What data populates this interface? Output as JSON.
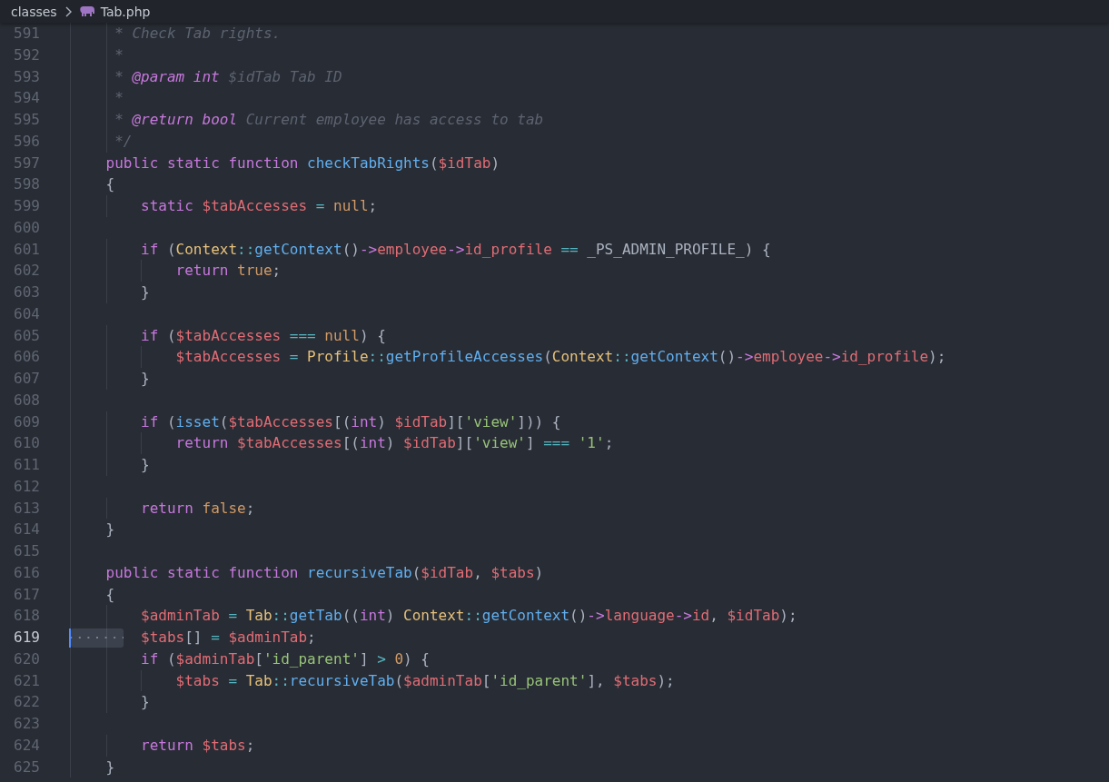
{
  "breadcrumb": {
    "folder": "classes",
    "file": "Tab.php"
  },
  "lines": [
    {
      "number": "591",
      "selected": false,
      "tokens": [
        {
          "text": "     * Check Tab rights.",
          "kind": "comment"
        }
      ]
    },
    {
      "number": "592",
      "selected": false,
      "tokens": [
        {
          "text": "     *",
          "kind": "comment"
        }
      ]
    },
    {
      "number": "593",
      "selected": false,
      "tokens": [
        {
          "text": "     * ",
          "kind": "comment"
        },
        {
          "text": "@param",
          "kind": "doctag"
        },
        {
          "text": " int",
          "kind": "doctag"
        },
        {
          "text": " $idTab Tab ID",
          "kind": "comment"
        }
      ]
    },
    {
      "number": "594",
      "selected": false,
      "tokens": [
        {
          "text": "     *",
          "kind": "comment"
        }
      ]
    },
    {
      "number": "595",
      "selected": false,
      "tokens": [
        {
          "text": "     * ",
          "kind": "comment"
        },
        {
          "text": "@return",
          "kind": "doctag"
        },
        {
          "text": " bool",
          "kind": "doctag"
        },
        {
          "text": " Current employee has access to tab",
          "kind": "comment"
        }
      ]
    },
    {
      "number": "596",
      "selected": false,
      "tokens": [
        {
          "text": "     */",
          "kind": "comment"
        }
      ]
    },
    {
      "number": "597",
      "selected": false,
      "tokens": [
        {
          "text": "    public static function",
          "kind": "keyword"
        },
        {
          "text": " checkTabRights",
          "kind": "function"
        },
        {
          "text": "(",
          "kind": "punct"
        },
        {
          "text": "$idTab",
          "kind": "variable"
        },
        {
          "text": ")",
          "kind": "punct"
        }
      ]
    },
    {
      "number": "598",
      "selected": false,
      "tokens": [
        {
          "text": "    {",
          "kind": "punct"
        }
      ]
    },
    {
      "number": "599",
      "selected": false,
      "tokens": [
        {
          "text": "        static",
          "kind": "keyword"
        },
        {
          "text": " $tabAccesses",
          "kind": "variable"
        },
        {
          "text": " =",
          "kind": "operator"
        },
        {
          "text": " null",
          "kind": "constant"
        },
        {
          "text": ";",
          "kind": "punct"
        }
      ]
    },
    {
      "number": "600",
      "selected": false
    },
    {
      "number": "601",
      "selected": false,
      "tokens": [
        {
          "text": "        if",
          "kind": "keyword"
        },
        {
          "text": " (",
          "kind": "punct"
        },
        {
          "text": "Context",
          "kind": "class"
        },
        {
          "text": "::",
          "kind": "operator"
        },
        {
          "text": "getContext",
          "kind": "function"
        },
        {
          "text": "()",
          "kind": "punct"
        },
        {
          "text": "->",
          "kind": "keyword"
        },
        {
          "text": "employee",
          "kind": "variable"
        },
        {
          "text": "->",
          "kind": "keyword"
        },
        {
          "text": "id_profile",
          "kind": "variable"
        },
        {
          "text": " ==",
          "kind": "operator"
        },
        {
          "text": " _PS_ADMIN_PROFILE_",
          "kind": "punct"
        },
        {
          "text": ") {",
          "kind": "punct"
        }
      ]
    },
    {
      "number": "602",
      "selected": false,
      "tokens": [
        {
          "text": "            return",
          "kind": "keyword"
        },
        {
          "text": " true",
          "kind": "constant"
        },
        {
          "text": ";",
          "kind": "punct"
        }
      ]
    },
    {
      "number": "603",
      "selected": false,
      "tokens": [
        {
          "text": "        }",
          "kind": "punct"
        }
      ]
    },
    {
      "number": "604",
      "selected": false
    },
    {
      "number": "605",
      "selected": false,
      "tokens": [
        {
          "text": "        if",
          "kind": "keyword"
        },
        {
          "text": " (",
          "kind": "punct"
        },
        {
          "text": "$tabAccesses",
          "kind": "variable"
        },
        {
          "text": " ===",
          "kind": "operator"
        },
        {
          "text": " null",
          "kind": "constant"
        },
        {
          "text": ") {",
          "kind": "punct"
        }
      ]
    },
    {
      "number": "606",
      "selected": false,
      "tokens": [
        {
          "text": "            $tabAccesses",
          "kind": "variable"
        },
        {
          "text": " =",
          "kind": "operator"
        },
        {
          "text": " Profile",
          "kind": "class"
        },
        {
          "text": "::",
          "kind": "operator"
        },
        {
          "text": "getProfileAccesses",
          "kind": "function"
        },
        {
          "text": "(",
          "kind": "punct"
        },
        {
          "text": "Context",
          "kind": "class"
        },
        {
          "text": "::",
          "kind": "operator"
        },
        {
          "text": "getContext",
          "kind": "function"
        },
        {
          "text": "()",
          "kind": "punct"
        },
        {
          "text": "->",
          "kind": "keyword"
        },
        {
          "text": "employee",
          "kind": "variable"
        },
        {
          "text": "->",
          "kind": "keyword"
        },
        {
          "text": "id_profile",
          "kind": "variable"
        },
        {
          "text": ");",
          "kind": "punct"
        }
      ]
    },
    {
      "number": "607",
      "selected": false,
      "tokens": [
        {
          "text": "        }",
          "kind": "punct"
        }
      ]
    },
    {
      "number": "608",
      "selected": false
    },
    {
      "number": "609",
      "selected": false,
      "tokens": [
        {
          "text": "        if",
          "kind": "keyword"
        },
        {
          "text": " (",
          "kind": "punct"
        },
        {
          "text": "isset",
          "kind": "function"
        },
        {
          "text": "(",
          "kind": "punct"
        },
        {
          "text": "$tabAccesses",
          "kind": "variable"
        },
        {
          "text": "[(",
          "kind": "punct"
        },
        {
          "text": "int",
          "kind": "keyword"
        },
        {
          "text": ") ",
          "kind": "punct"
        },
        {
          "text": "$idTab",
          "kind": "variable"
        },
        {
          "text": "][",
          "kind": "punct"
        },
        {
          "text": "'view'",
          "kind": "string"
        },
        {
          "text": "])) {",
          "kind": "punct"
        }
      ]
    },
    {
      "number": "610",
      "selected": false,
      "tokens": [
        {
          "text": "            return",
          "kind": "keyword"
        },
        {
          "text": " $tabAccesses",
          "kind": "variable"
        },
        {
          "text": "[(",
          "kind": "punct"
        },
        {
          "text": "int",
          "kind": "keyword"
        },
        {
          "text": ") ",
          "kind": "punct"
        },
        {
          "text": "$idTab",
          "kind": "variable"
        },
        {
          "text": "][",
          "kind": "punct"
        },
        {
          "text": "'view'",
          "kind": "string"
        },
        {
          "text": "]",
          "kind": "punct"
        },
        {
          "text": " ===",
          "kind": "operator"
        },
        {
          "text": " '1'",
          "kind": "string"
        },
        {
          "text": ";",
          "kind": "punct"
        }
      ]
    },
    {
      "number": "611",
      "selected": false,
      "tokens": [
        {
          "text": "        }",
          "kind": "punct"
        }
      ]
    },
    {
      "number": "612",
      "selected": false
    },
    {
      "number": "613",
      "selected": false,
      "tokens": [
        {
          "text": "        return",
          "kind": "keyword"
        },
        {
          "text": " false",
          "kind": "constant"
        },
        {
          "text": ";",
          "kind": "punct"
        }
      ]
    },
    {
      "number": "614",
      "selected": false,
      "tokens": [
        {
          "text": "    }",
          "kind": "punct"
        }
      ]
    },
    {
      "number": "615",
      "selected": false
    },
    {
      "number": "616",
      "selected": false,
      "tokens": [
        {
          "text": "    public static function",
          "kind": "keyword"
        },
        {
          "text": " recursiveTab",
          "kind": "function"
        },
        {
          "text": "(",
          "kind": "punct"
        },
        {
          "text": "$idTab",
          "kind": "variable"
        },
        {
          "text": ", ",
          "kind": "punct"
        },
        {
          "text": "$tabs",
          "kind": "variable"
        },
        {
          "text": ")",
          "kind": "punct"
        }
      ]
    },
    {
      "number": "617",
      "selected": false,
      "tokens": [
        {
          "text": "    {",
          "kind": "punct"
        }
      ]
    },
    {
      "number": "618",
      "selected": false,
      "tokens": [
        {
          "text": "        $adminTab",
          "kind": "variable"
        },
        {
          "text": " =",
          "kind": "operator"
        },
        {
          "text": " Tab",
          "kind": "class"
        },
        {
          "text": "::",
          "kind": "operator"
        },
        {
          "text": "getTab",
          "kind": "function"
        },
        {
          "text": "((",
          "kind": "punct"
        },
        {
          "text": "int",
          "kind": "keyword"
        },
        {
          "text": ") ",
          "kind": "punct"
        },
        {
          "text": "Context",
          "kind": "class"
        },
        {
          "text": "::",
          "kind": "operator"
        },
        {
          "text": "getContext",
          "kind": "function"
        },
        {
          "text": "()",
          "kind": "punct"
        },
        {
          "text": "->",
          "kind": "keyword"
        },
        {
          "text": "language",
          "kind": "variable"
        },
        {
          "text": "->",
          "kind": "keyword"
        },
        {
          "text": "id",
          "kind": "variable"
        },
        {
          "text": ", ",
          "kind": "punct"
        },
        {
          "text": "$idTab",
          "kind": "variable"
        },
        {
          "text": ");",
          "kind": "punct"
        }
      ]
    },
    {
      "number": "619",
      "selected": true,
      "tokens": [
        {
          "text": "        $tabs",
          "kind": "variable"
        },
        {
          "text": "[]",
          "kind": "punct"
        },
        {
          "text": " =",
          "kind": "operator"
        },
        {
          "text": " $adminTab",
          "kind": "variable"
        },
        {
          "text": ";",
          "kind": "punct"
        }
      ]
    },
    {
      "number": "620",
      "selected": false,
      "tokens": [
        {
          "text": "        if",
          "kind": "keyword"
        },
        {
          "text": " (",
          "kind": "punct"
        },
        {
          "text": "$adminTab",
          "kind": "variable"
        },
        {
          "text": "[",
          "kind": "punct"
        },
        {
          "text": "'id_parent'",
          "kind": "string"
        },
        {
          "text": "]",
          "kind": "punct"
        },
        {
          "text": " >",
          "kind": "operator"
        },
        {
          "text": " 0",
          "kind": "constant"
        },
        {
          "text": ") {",
          "kind": "punct"
        }
      ]
    },
    {
      "number": "621",
      "selected": false,
      "tokens": [
        {
          "text": "            $tabs",
          "kind": "variable"
        },
        {
          "text": " =",
          "kind": "operator"
        },
        {
          "text": " Tab",
          "kind": "class"
        },
        {
          "text": "::",
          "kind": "operator"
        },
        {
          "text": "recursiveTab",
          "kind": "function"
        },
        {
          "text": "(",
          "kind": "punct"
        },
        {
          "text": "$adminTab",
          "kind": "variable"
        },
        {
          "text": "[",
          "kind": "punct"
        },
        {
          "text": "'id_parent'",
          "kind": "string"
        },
        {
          "text": "], ",
          "kind": "punct"
        },
        {
          "text": "$tabs",
          "kind": "variable"
        },
        {
          "text": ");",
          "kind": "punct"
        }
      ]
    },
    {
      "number": "622",
      "selected": false,
      "tokens": [
        {
          "text": "        }",
          "kind": "punct"
        }
      ]
    },
    {
      "number": "623",
      "selected": false
    },
    {
      "number": "624",
      "selected": false,
      "tokens": [
        {
          "text": "        return",
          "kind": "keyword"
        },
        {
          "text": " $tabs",
          "kind": "variable"
        },
        {
          "text": ";",
          "kind": "punct"
        }
      ]
    },
    {
      "number": "625",
      "selected": false,
      "tokens": [
        {
          "text": "    }",
          "kind": "punct"
        }
      ]
    }
  ]
}
